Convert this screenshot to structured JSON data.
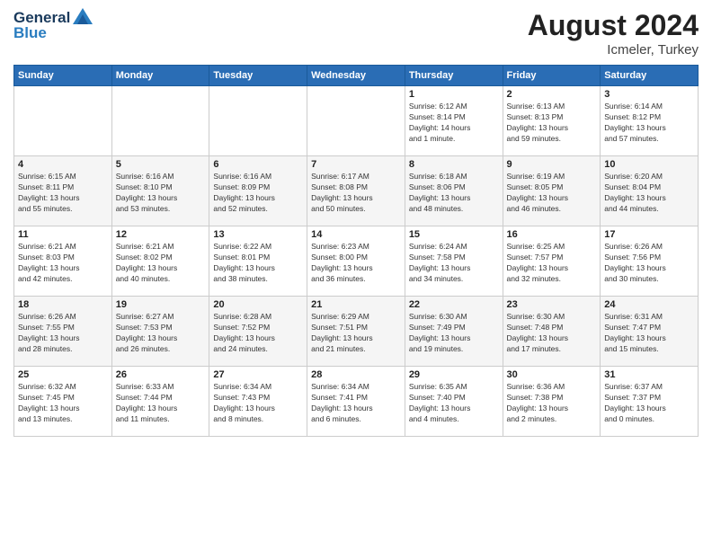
{
  "header": {
    "logo_line1": "General",
    "logo_line2": "Blue",
    "month_year": "August 2024",
    "location": "Icmeler, Turkey"
  },
  "days_of_week": [
    "Sunday",
    "Monday",
    "Tuesday",
    "Wednesday",
    "Thursday",
    "Friday",
    "Saturday"
  ],
  "weeks": [
    [
      {
        "day": "",
        "info": ""
      },
      {
        "day": "",
        "info": ""
      },
      {
        "day": "",
        "info": ""
      },
      {
        "day": "",
        "info": ""
      },
      {
        "day": "1",
        "info": "Sunrise: 6:12 AM\nSunset: 8:14 PM\nDaylight: 14 hours\nand 1 minute."
      },
      {
        "day": "2",
        "info": "Sunrise: 6:13 AM\nSunset: 8:13 PM\nDaylight: 13 hours\nand 59 minutes."
      },
      {
        "day": "3",
        "info": "Sunrise: 6:14 AM\nSunset: 8:12 PM\nDaylight: 13 hours\nand 57 minutes."
      }
    ],
    [
      {
        "day": "4",
        "info": "Sunrise: 6:15 AM\nSunset: 8:11 PM\nDaylight: 13 hours\nand 55 minutes."
      },
      {
        "day": "5",
        "info": "Sunrise: 6:16 AM\nSunset: 8:10 PM\nDaylight: 13 hours\nand 53 minutes."
      },
      {
        "day": "6",
        "info": "Sunrise: 6:16 AM\nSunset: 8:09 PM\nDaylight: 13 hours\nand 52 minutes."
      },
      {
        "day": "7",
        "info": "Sunrise: 6:17 AM\nSunset: 8:08 PM\nDaylight: 13 hours\nand 50 minutes."
      },
      {
        "day": "8",
        "info": "Sunrise: 6:18 AM\nSunset: 8:06 PM\nDaylight: 13 hours\nand 48 minutes."
      },
      {
        "day": "9",
        "info": "Sunrise: 6:19 AM\nSunset: 8:05 PM\nDaylight: 13 hours\nand 46 minutes."
      },
      {
        "day": "10",
        "info": "Sunrise: 6:20 AM\nSunset: 8:04 PM\nDaylight: 13 hours\nand 44 minutes."
      }
    ],
    [
      {
        "day": "11",
        "info": "Sunrise: 6:21 AM\nSunset: 8:03 PM\nDaylight: 13 hours\nand 42 minutes."
      },
      {
        "day": "12",
        "info": "Sunrise: 6:21 AM\nSunset: 8:02 PM\nDaylight: 13 hours\nand 40 minutes."
      },
      {
        "day": "13",
        "info": "Sunrise: 6:22 AM\nSunset: 8:01 PM\nDaylight: 13 hours\nand 38 minutes."
      },
      {
        "day": "14",
        "info": "Sunrise: 6:23 AM\nSunset: 8:00 PM\nDaylight: 13 hours\nand 36 minutes."
      },
      {
        "day": "15",
        "info": "Sunrise: 6:24 AM\nSunset: 7:58 PM\nDaylight: 13 hours\nand 34 minutes."
      },
      {
        "day": "16",
        "info": "Sunrise: 6:25 AM\nSunset: 7:57 PM\nDaylight: 13 hours\nand 32 minutes."
      },
      {
        "day": "17",
        "info": "Sunrise: 6:26 AM\nSunset: 7:56 PM\nDaylight: 13 hours\nand 30 minutes."
      }
    ],
    [
      {
        "day": "18",
        "info": "Sunrise: 6:26 AM\nSunset: 7:55 PM\nDaylight: 13 hours\nand 28 minutes."
      },
      {
        "day": "19",
        "info": "Sunrise: 6:27 AM\nSunset: 7:53 PM\nDaylight: 13 hours\nand 26 minutes."
      },
      {
        "day": "20",
        "info": "Sunrise: 6:28 AM\nSunset: 7:52 PM\nDaylight: 13 hours\nand 24 minutes."
      },
      {
        "day": "21",
        "info": "Sunrise: 6:29 AM\nSunset: 7:51 PM\nDaylight: 13 hours\nand 21 minutes."
      },
      {
        "day": "22",
        "info": "Sunrise: 6:30 AM\nSunset: 7:49 PM\nDaylight: 13 hours\nand 19 minutes."
      },
      {
        "day": "23",
        "info": "Sunrise: 6:30 AM\nSunset: 7:48 PM\nDaylight: 13 hours\nand 17 minutes."
      },
      {
        "day": "24",
        "info": "Sunrise: 6:31 AM\nSunset: 7:47 PM\nDaylight: 13 hours\nand 15 minutes."
      }
    ],
    [
      {
        "day": "25",
        "info": "Sunrise: 6:32 AM\nSunset: 7:45 PM\nDaylight: 13 hours\nand 13 minutes."
      },
      {
        "day": "26",
        "info": "Sunrise: 6:33 AM\nSunset: 7:44 PM\nDaylight: 13 hours\nand 11 minutes."
      },
      {
        "day": "27",
        "info": "Sunrise: 6:34 AM\nSunset: 7:43 PM\nDaylight: 13 hours\nand 8 minutes."
      },
      {
        "day": "28",
        "info": "Sunrise: 6:34 AM\nSunset: 7:41 PM\nDaylight: 13 hours\nand 6 minutes."
      },
      {
        "day": "29",
        "info": "Sunrise: 6:35 AM\nSunset: 7:40 PM\nDaylight: 13 hours\nand 4 minutes."
      },
      {
        "day": "30",
        "info": "Sunrise: 6:36 AM\nSunset: 7:38 PM\nDaylight: 13 hours\nand 2 minutes."
      },
      {
        "day": "31",
        "info": "Sunrise: 6:37 AM\nSunset: 7:37 PM\nDaylight: 13 hours\nand 0 minutes."
      }
    ]
  ]
}
